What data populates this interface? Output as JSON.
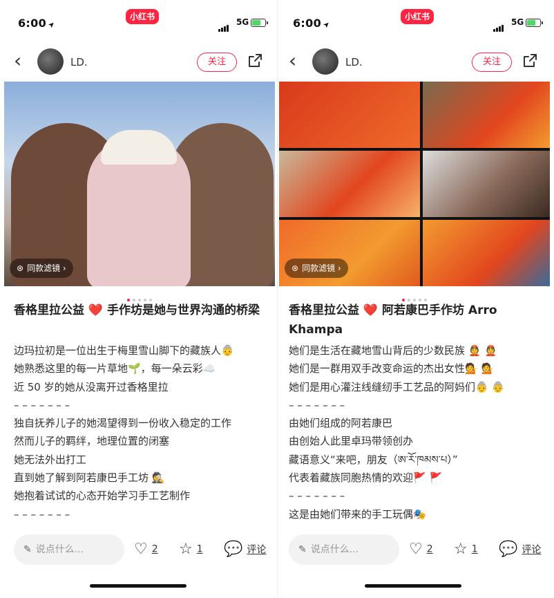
{
  "screens": [
    {
      "status": {
        "time": "6:00",
        "brand": "小红书",
        "network": "5G"
      },
      "nav": {
        "username": "LD.",
        "follow": "关注"
      },
      "media": {
        "filter_label": "同款滤镜"
      },
      "post": {
        "title": "香格里拉公益 ❤️ 手作坊是她与世界沟通的桥梁",
        "lines": [
          "边玛拉初是一位出生于梅里雪山脚下的藏族人👵",
          "她熟悉这里的每一片草地🌱，每一朵云彩☁️",
          "近 50 岁的她从没离开过香格里拉",
          "–     –     –     –     –     –     –",
          "独自抚养儿子的她渴望得到一份收入稳定的工作",
          "然而儿子的羁绊，地理位置的闭塞",
          "她无法外出打工",
          "直到她了解到阿若康巴手工坊 🕵",
          "她抱着试试的心态开始学习手工艺制作",
          "–     –     –     –     –     –     –"
        ]
      },
      "bar": {
        "placeholder": "说点什么...",
        "likes": "2",
        "stars": "1",
        "comment": "评论"
      }
    },
    {
      "status": {
        "time": "6:00",
        "brand": "小红书",
        "network": "5G"
      },
      "nav": {
        "username": "LD.",
        "follow": "关注"
      },
      "media": {
        "filter_label": "同款滤镜"
      },
      "post": {
        "title": "香格里拉公益 ❤️ 阿若康巴手作坊 Arro Khampa",
        "lines": [
          "她们是生活在藏地雪山背后的少数民族 👲 👲",
          "她们是一群用双手改变命运的杰出女性💁 💁",
          "她们是用心灌注线缝纫手工艺品的阿妈们👵 👵",
          "–     –     –     –     –     –     –",
          "由她们组成的阿若康巴",
          "由创始人此里卓玛带领创办",
          "藏语意义“来吧，朋友（ཨ་རོ་ཁམས་པ）”",
          "代表着藏族同胞热情的欢迎🚩 🚩",
          "–     –     –     –     –     –     –",
          "这是由她们带来的手工玩偶🎭"
        ]
      },
      "bar": {
        "placeholder": "说点什么...",
        "likes": "2",
        "stars": "1",
        "comment": "评论"
      }
    }
  ]
}
